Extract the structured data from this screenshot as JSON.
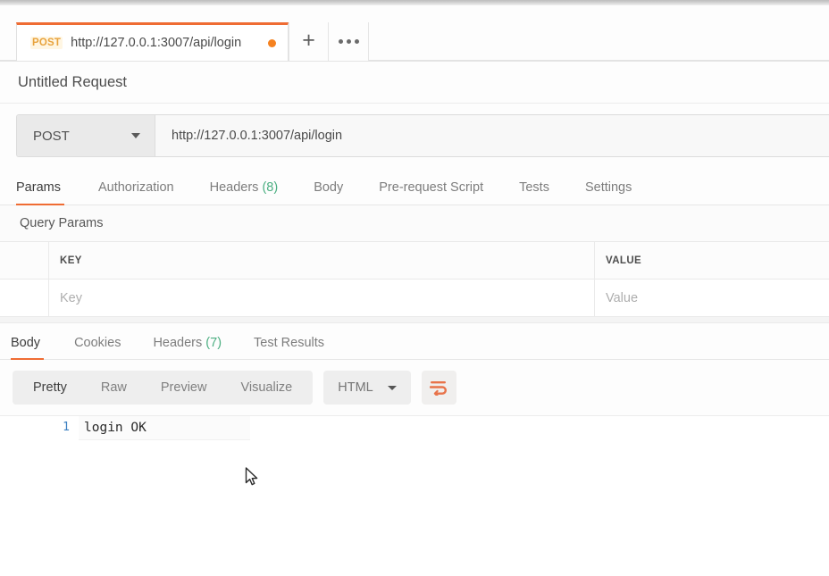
{
  "tab_bar": {
    "request_tab": {
      "method": "POST",
      "url": "http://127.0.0.1:3007/api/login",
      "unsaved_indicator": "unsaved-dot"
    },
    "new_tab_label": "+",
    "more_label": "•••"
  },
  "request": {
    "title": "Untitled Request",
    "method": "POST",
    "method_caret": "chevron-down-icon",
    "url": "http://127.0.0.1:3007/api/login",
    "tabs": [
      {
        "label": "Params",
        "count": "",
        "active": true
      },
      {
        "label": "Authorization",
        "count": "",
        "active": false
      },
      {
        "label": "Headers",
        "count": "(8)",
        "active": false
      },
      {
        "label": "Body",
        "count": "",
        "active": false
      },
      {
        "label": "Pre-request Script",
        "count": "",
        "active": false
      },
      {
        "label": "Tests",
        "count": "",
        "active": false
      },
      {
        "label": "Settings",
        "count": "",
        "active": false
      }
    ]
  },
  "query_params": {
    "section_title": "Query Params",
    "columns": [
      "KEY",
      "VALUE"
    ],
    "rows": [
      {
        "key_placeholder": "Key",
        "value_placeholder": "Value"
      }
    ]
  },
  "response": {
    "tabs": [
      {
        "label": "Body",
        "count": "",
        "active": true
      },
      {
        "label": "Cookies",
        "count": "",
        "active": false
      },
      {
        "label": "Headers",
        "count": "(7)",
        "active": false
      },
      {
        "label": "Test Results",
        "count": "",
        "active": false
      }
    ],
    "view_modes": [
      {
        "label": "Pretty",
        "active": true
      },
      {
        "label": "Raw",
        "active": false
      },
      {
        "label": "Preview",
        "active": false
      },
      {
        "label": "Visualize",
        "active": false
      }
    ],
    "format": "HTML",
    "format_caret": "chevron-down-icon",
    "wrap_icon": "word-wrap-icon",
    "body_lines": [
      {
        "number": "1",
        "text": "login OK"
      }
    ]
  },
  "colors": {
    "accent_orange": "#ef6c33",
    "method_post": "#e8a33d",
    "count_green": "#4caf82",
    "line_number_blue": "#3a7fc1"
  }
}
